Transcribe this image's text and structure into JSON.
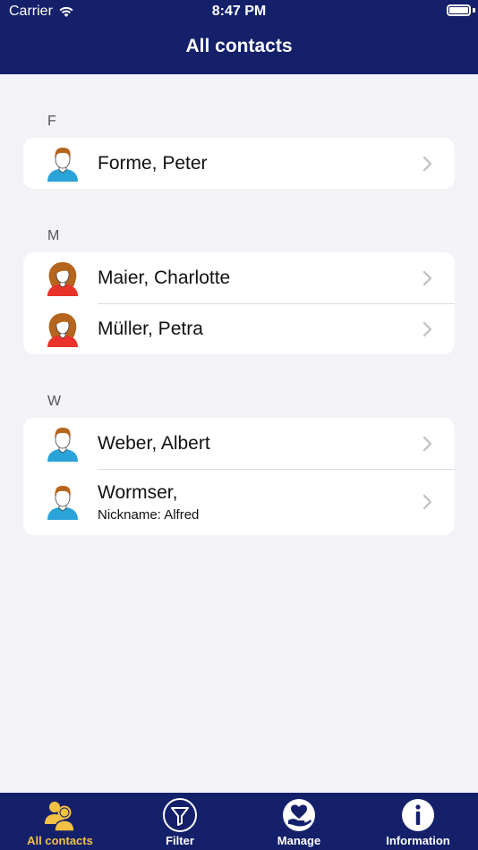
{
  "status_bar": {
    "carrier": "Carrier",
    "time": "8:47 PM"
  },
  "nav": {
    "title": "All contacts"
  },
  "sections": [
    {
      "letter": "F",
      "contacts": [
        {
          "name": "Forme, Peter",
          "gender": "male"
        }
      ]
    },
    {
      "letter": "M",
      "contacts": [
        {
          "name": "Maier, Charlotte",
          "gender": "female"
        },
        {
          "name": "Müller, Petra",
          "gender": "female"
        }
      ]
    },
    {
      "letter": "W",
      "contacts": [
        {
          "name": "Weber, Albert",
          "gender": "male"
        },
        {
          "name": "Wormser,",
          "nickname": "Nickname: Alfred",
          "gender": "male"
        }
      ]
    }
  ],
  "tabs": [
    {
      "label": "All contacts",
      "icon": "contacts-icon",
      "active": true
    },
    {
      "label": "Filter",
      "icon": "filter-icon",
      "active": false
    },
    {
      "label": "Manage",
      "icon": "manage-icon",
      "active": false
    },
    {
      "label": "Information",
      "icon": "info-icon",
      "active": false
    }
  ],
  "colors": {
    "nav_background": "#14206a",
    "background": "#f2f2f7",
    "active_tab": "#f2c043",
    "male_shirt": "#2aa3d8",
    "female_shirt": "#e8322a",
    "hair": "#b5651d"
  }
}
